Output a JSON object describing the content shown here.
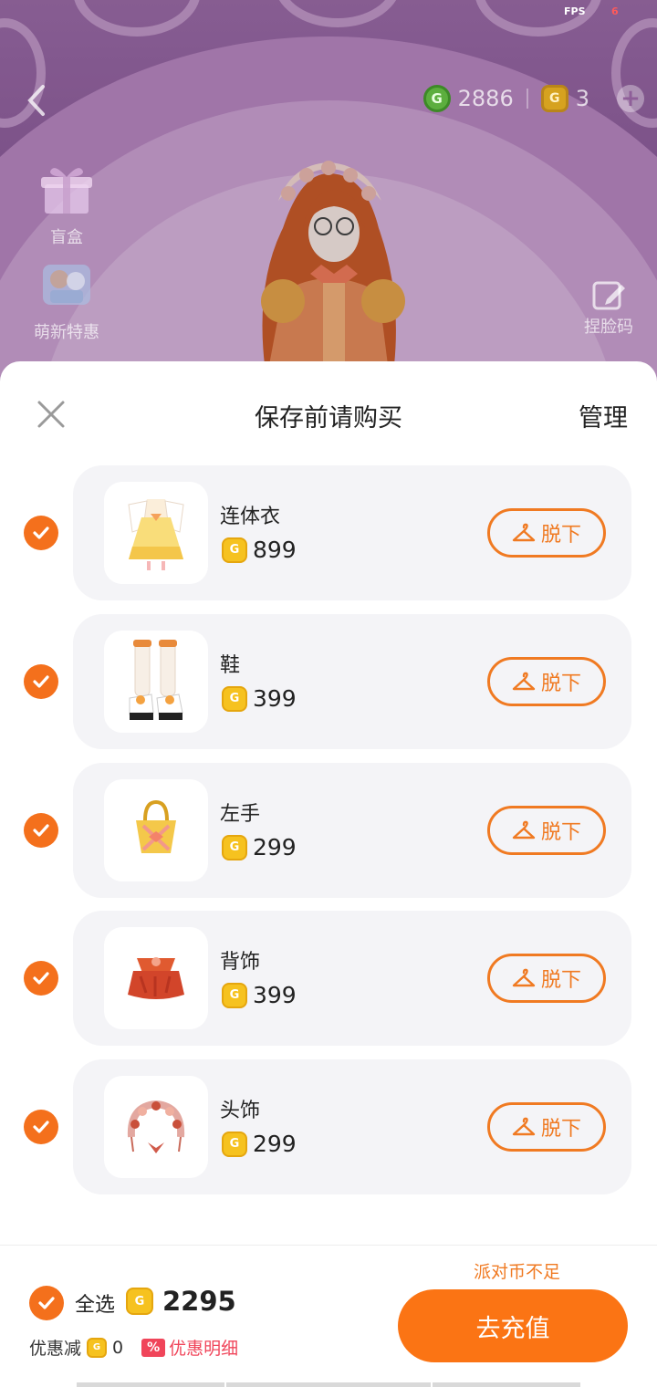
{
  "status": {
    "fps_label": "FPS",
    "fps_value": "6"
  },
  "scene": {
    "currency": {
      "party_coins": "2886",
      "gold": "3"
    },
    "side_entries": {
      "blind_box": "盲盒",
      "newbie_offer": "萌新特惠",
      "face_code": "捏脸码"
    }
  },
  "sheet": {
    "title": "保存前请购买",
    "manage_label": "管理",
    "remove_label": "脱下",
    "items": [
      {
        "name": "连体衣",
        "price": "899",
        "icon": "dress-icon"
      },
      {
        "name": "鞋",
        "price": "399",
        "icon": "boots-icon"
      },
      {
        "name": "左手",
        "price": "299",
        "icon": "handbag-icon"
      },
      {
        "name": "背饰",
        "price": "399",
        "icon": "back-accessory-icon"
      },
      {
        "name": "头饰",
        "price": "299",
        "icon": "headdress-icon"
      }
    ]
  },
  "footer": {
    "select_all_label": "全选",
    "total": "2295",
    "discount_label": "优惠减",
    "discount_value": "0",
    "discount_pct": "%",
    "discount_detail": "优惠明细",
    "insufficient": "派对币不足",
    "recharge_label": "去充值"
  },
  "colors": {
    "accent": "#fb7414",
    "check": "#f4701c",
    "coin": "#f6c21f",
    "discount": "#f0455a"
  }
}
